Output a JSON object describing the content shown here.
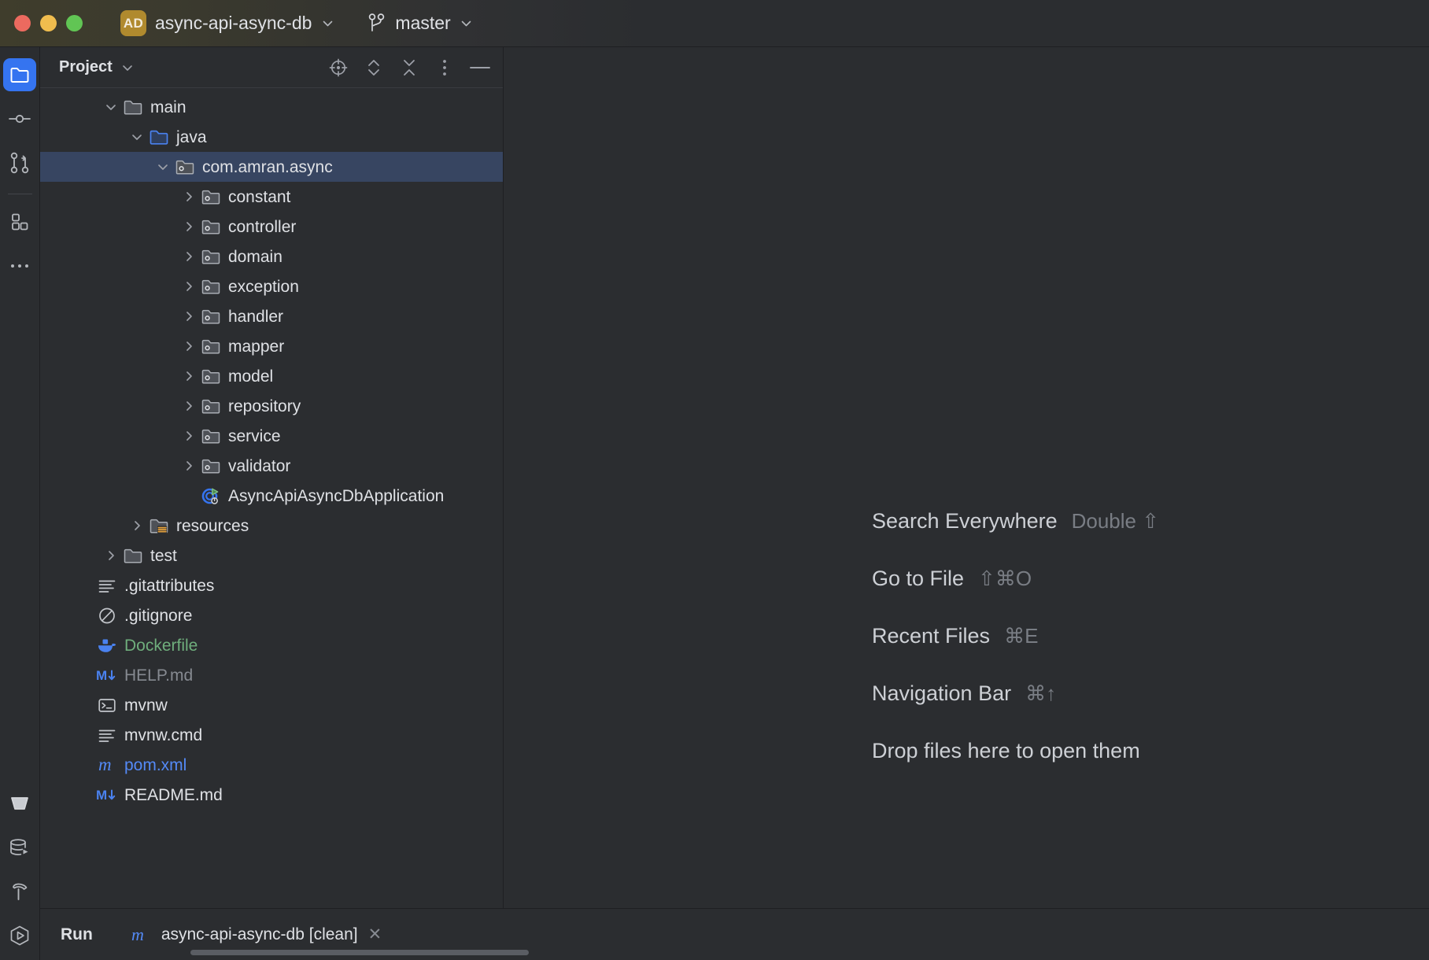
{
  "window": {
    "traffic_lights": [
      "close",
      "minimize",
      "zoom"
    ],
    "project_badge": "AD",
    "project_name": "async-api-async-db",
    "branch_name": "master"
  },
  "rail": {
    "top_items": [
      {
        "name": "project",
        "icon": "folder-icon",
        "active": true
      },
      {
        "name": "commit",
        "icon": "commit-icon",
        "active": false
      },
      {
        "name": "pull-requests",
        "icon": "pull-request-icon",
        "active": false
      }
    ],
    "secondary_items": [
      {
        "name": "structure",
        "icon": "structure-icon",
        "active": false
      },
      {
        "name": "more",
        "icon": "more-dots-icon",
        "active": false
      }
    ],
    "bottom_items": [
      {
        "name": "terminal",
        "icon": "terminal-hex-icon",
        "active": false
      },
      {
        "name": "database",
        "icon": "database-icon",
        "active": false
      },
      {
        "name": "build",
        "icon": "hammer-icon",
        "active": false
      },
      {
        "name": "run",
        "icon": "run-hex-icon",
        "active": false
      }
    ]
  },
  "panel": {
    "title": "Project",
    "tools": [
      {
        "name": "select-opened-file",
        "icon": "crosshair-icon"
      },
      {
        "name": "expand-all",
        "icon": "expand-all-icon"
      },
      {
        "name": "collapse-all",
        "icon": "collapse-all-icon"
      },
      {
        "name": "options",
        "icon": "vertical-dots-icon"
      },
      {
        "name": "hide",
        "icon": "minus-icon"
      }
    ]
  },
  "tree": {
    "rows": [
      {
        "label": "main",
        "indent": 4,
        "twisty": "down",
        "icon": "folder-icon",
        "selected": false,
        "color": ""
      },
      {
        "label": "java",
        "indent": 5,
        "twisty": "down",
        "icon": "source-root-folder-icon",
        "selected": false,
        "color": ""
      },
      {
        "label": "com.amran.async",
        "indent": 6,
        "twisty": "down",
        "icon": "package-icon",
        "selected": true,
        "color": ""
      },
      {
        "label": "constant",
        "indent": 7,
        "twisty": "right",
        "icon": "package-icon",
        "selected": false,
        "color": ""
      },
      {
        "label": "controller",
        "indent": 7,
        "twisty": "right",
        "icon": "package-icon",
        "selected": false,
        "color": ""
      },
      {
        "label": "domain",
        "indent": 7,
        "twisty": "right",
        "icon": "package-icon",
        "selected": false,
        "color": ""
      },
      {
        "label": "exception",
        "indent": 7,
        "twisty": "right",
        "icon": "package-icon",
        "selected": false,
        "color": ""
      },
      {
        "label": "handler",
        "indent": 7,
        "twisty": "right",
        "icon": "package-icon",
        "selected": false,
        "color": ""
      },
      {
        "label": "mapper",
        "indent": 7,
        "twisty": "right",
        "icon": "package-icon",
        "selected": false,
        "color": ""
      },
      {
        "label": "model",
        "indent": 7,
        "twisty": "right",
        "icon": "package-icon",
        "selected": false,
        "color": ""
      },
      {
        "label": "repository",
        "indent": 7,
        "twisty": "right",
        "icon": "package-icon",
        "selected": false,
        "color": ""
      },
      {
        "label": "service",
        "indent": 7,
        "twisty": "right",
        "icon": "package-icon",
        "selected": false,
        "color": ""
      },
      {
        "label": "validator",
        "indent": 7,
        "twisty": "right",
        "icon": "package-icon",
        "selected": false,
        "color": ""
      },
      {
        "label": "AsyncApiAsyncDbApplication",
        "indent": 7,
        "twisty": "none",
        "icon": "spring-boot-class-icon",
        "selected": false,
        "color": ""
      },
      {
        "label": "resources",
        "indent": 5,
        "twisty": "right",
        "icon": "resources-folder-icon",
        "selected": false,
        "color": ""
      },
      {
        "label": "test",
        "indent": 4,
        "twisty": "right",
        "icon": "folder-icon",
        "selected": false,
        "color": ""
      },
      {
        "label": ".gitattributes",
        "indent": 3,
        "twisty": "none",
        "icon": "text-file-icon",
        "selected": false,
        "color": ""
      },
      {
        "label": ".gitignore",
        "indent": 3,
        "twisty": "none",
        "icon": "gitignore-icon",
        "selected": false,
        "color": ""
      },
      {
        "label": "Dockerfile",
        "indent": 3,
        "twisty": "none",
        "icon": "docker-icon",
        "selected": false,
        "color": "green"
      },
      {
        "label": "HELP.md",
        "indent": 3,
        "twisty": "none",
        "icon": "markdown-icon",
        "selected": false,
        "color": "gray"
      },
      {
        "label": "mvnw",
        "indent": 3,
        "twisty": "none",
        "icon": "shell-script-icon",
        "selected": false,
        "color": ""
      },
      {
        "label": "mvnw.cmd",
        "indent": 3,
        "twisty": "none",
        "icon": "text-file-icon",
        "selected": false,
        "color": ""
      },
      {
        "label": "pom.xml",
        "indent": 3,
        "twisty": "none",
        "icon": "maven-icon",
        "selected": false,
        "color": "blue"
      },
      {
        "label": "README.md",
        "indent": 3,
        "twisty": "none",
        "icon": "markdown-icon",
        "selected": false,
        "color": ""
      }
    ]
  },
  "editor": {
    "hints": [
      {
        "label": "Search Everywhere",
        "keys": "Double ⇧"
      },
      {
        "label": "Go to File",
        "keys": "⇧⌘O"
      },
      {
        "label": "Recent Files",
        "keys": "⌘E"
      },
      {
        "label": "Navigation Bar",
        "keys": "⌘↑"
      },
      {
        "label": "Drop files here to open them",
        "keys": ""
      }
    ]
  },
  "runbar": {
    "label": "Run",
    "tab_name": "async-api-async-db [clean]",
    "tab_icon": "maven-icon",
    "close_glyph": "✕"
  },
  "colors": {
    "accent": "#3574f0",
    "selection": "#374561",
    "panel_bg": "#2b2d30",
    "border": "#1e1f22",
    "text": "#dfe1e5",
    "muted_text": "#868a91",
    "green": "#6fae7c",
    "blue": "#548af7",
    "badge": "#b08a2e"
  }
}
